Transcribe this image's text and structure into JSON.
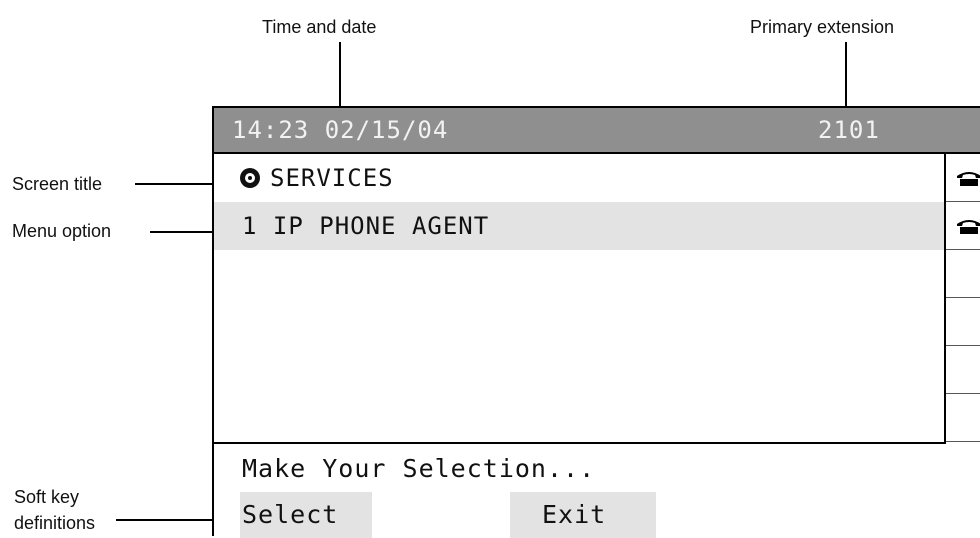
{
  "callouts": {
    "time_and_date": "Time and date",
    "primary_extension": "Primary extension",
    "screen_title": "Screen title",
    "menu_option": "Menu option",
    "soft_key_line1": "Soft key",
    "soft_key_line2": "definitions"
  },
  "display": {
    "time_date": "14:23 02/15/04",
    "extension": "2101",
    "screen_title": "SERVICES",
    "screen_title_icon": "services-globe-icon",
    "menu_option": "1 IP PHONE AGENT",
    "line_icons": [
      "phone-icon",
      "phone-icon"
    ],
    "status": "Make Your Selection...",
    "softkeys": [
      "Select",
      "Exit"
    ]
  },
  "colors": {
    "header_bg": "#8f8f8f",
    "header_text": "#f2f2f2",
    "highlight_bg": "#e3e3e3"
  }
}
